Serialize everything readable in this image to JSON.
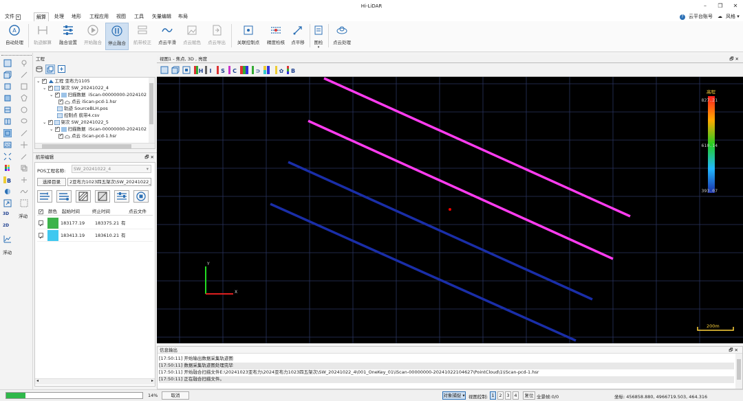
{
  "app": {
    "title": "Hi-LiDAR"
  },
  "menu": {
    "file": "文件",
    "items": [
      "解算",
      "处理",
      "地形",
      "工程应用",
      "视图",
      "工具",
      "矢量编辑",
      "布局"
    ],
    "account": "云平台账号",
    "style": "风格"
  },
  "ribbon": {
    "buttons": [
      "自动处理",
      "轨迹解算",
      "融合设置",
      "开始融合",
      "停止融合",
      "航带校正",
      "点云平滑",
      "点云赋色",
      "点云导出",
      "关联控制点",
      "精度检核",
      "点平移",
      "图检",
      "点云处理"
    ]
  },
  "lefttools": {
    "float1": "浮动",
    "label3d": "3D",
    "label2d": "2D",
    "float2": "浮动"
  },
  "project_panel": {
    "title": "工程",
    "tree": [
      "工程 亚布力1105",
      "架次 SW_20241022_4",
      "扫描数据",
      "iScan-00000000-2024102",
      "点云",
      "iScan-pcd-1.hsr",
      "轨迹 SourceBLH.pos",
      "控制点 航带4.csv",
      "架次 SW_20241022_5",
      "扫描数据",
      "iScan-00000000-2024102",
      "点云",
      "iScan-pcd-1.hsr"
    ]
  },
  "strip_panel": {
    "title": "航带编辑",
    "pos_label": "POS工程名称:",
    "pos_value": "SW_20241022_4",
    "dir_button": "选择目录",
    "dir_value": "2亚布力1023四五架次\\SW_20241022_4\\pos",
    "columns": [
      "颜色",
      "起始时间",
      "终止时间",
      "点云文件"
    ],
    "rows": [
      {
        "color": "#3cb34a",
        "start": "183177.19",
        "end": "183375.21",
        "file": "有"
      },
      {
        "color": "#3fc8f0",
        "start": "183413.19",
        "end": "183610.21",
        "file": "有"
      }
    ]
  },
  "view": {
    "title": "视图1 - 焦点, 3D , 亮度",
    "legend_title": "高程",
    "legend_values": [
      "827.21",
      "610.14",
      "393.07"
    ],
    "scale_label": "200m",
    "axis_x": "X",
    "axis_y": "Y"
  },
  "output": {
    "title": "信息输出",
    "lines": [
      "[17:50:11] 开始输出数据采集轨迹图",
      "[17:50:11] 数据采集轨迹图处理完毕",
      "[17:50:11] 开始融合扫描文件E:\\20241023亚布力\\2024亚布力1023四五架次\\SW_20241022_4\\001_OneKey_01\\iScan-00000000-20241022104627\\PointCloud\\1\\iScan-pcd-1.hsr",
      "[17:50:11] 正在融合扫描文件。"
    ]
  },
  "status": {
    "progress": 14,
    "progress_text": "14%",
    "cancel": "取消",
    "snap": "对象捕捉",
    "view_ctrl": "视图控制:",
    "view_nums": [
      "1",
      "2",
      "3",
      "4"
    ],
    "reset": "复位",
    "selected": "全景帧:0/0",
    "coords": "坐标: 456858.880, 4966719.503, 464.316"
  }
}
